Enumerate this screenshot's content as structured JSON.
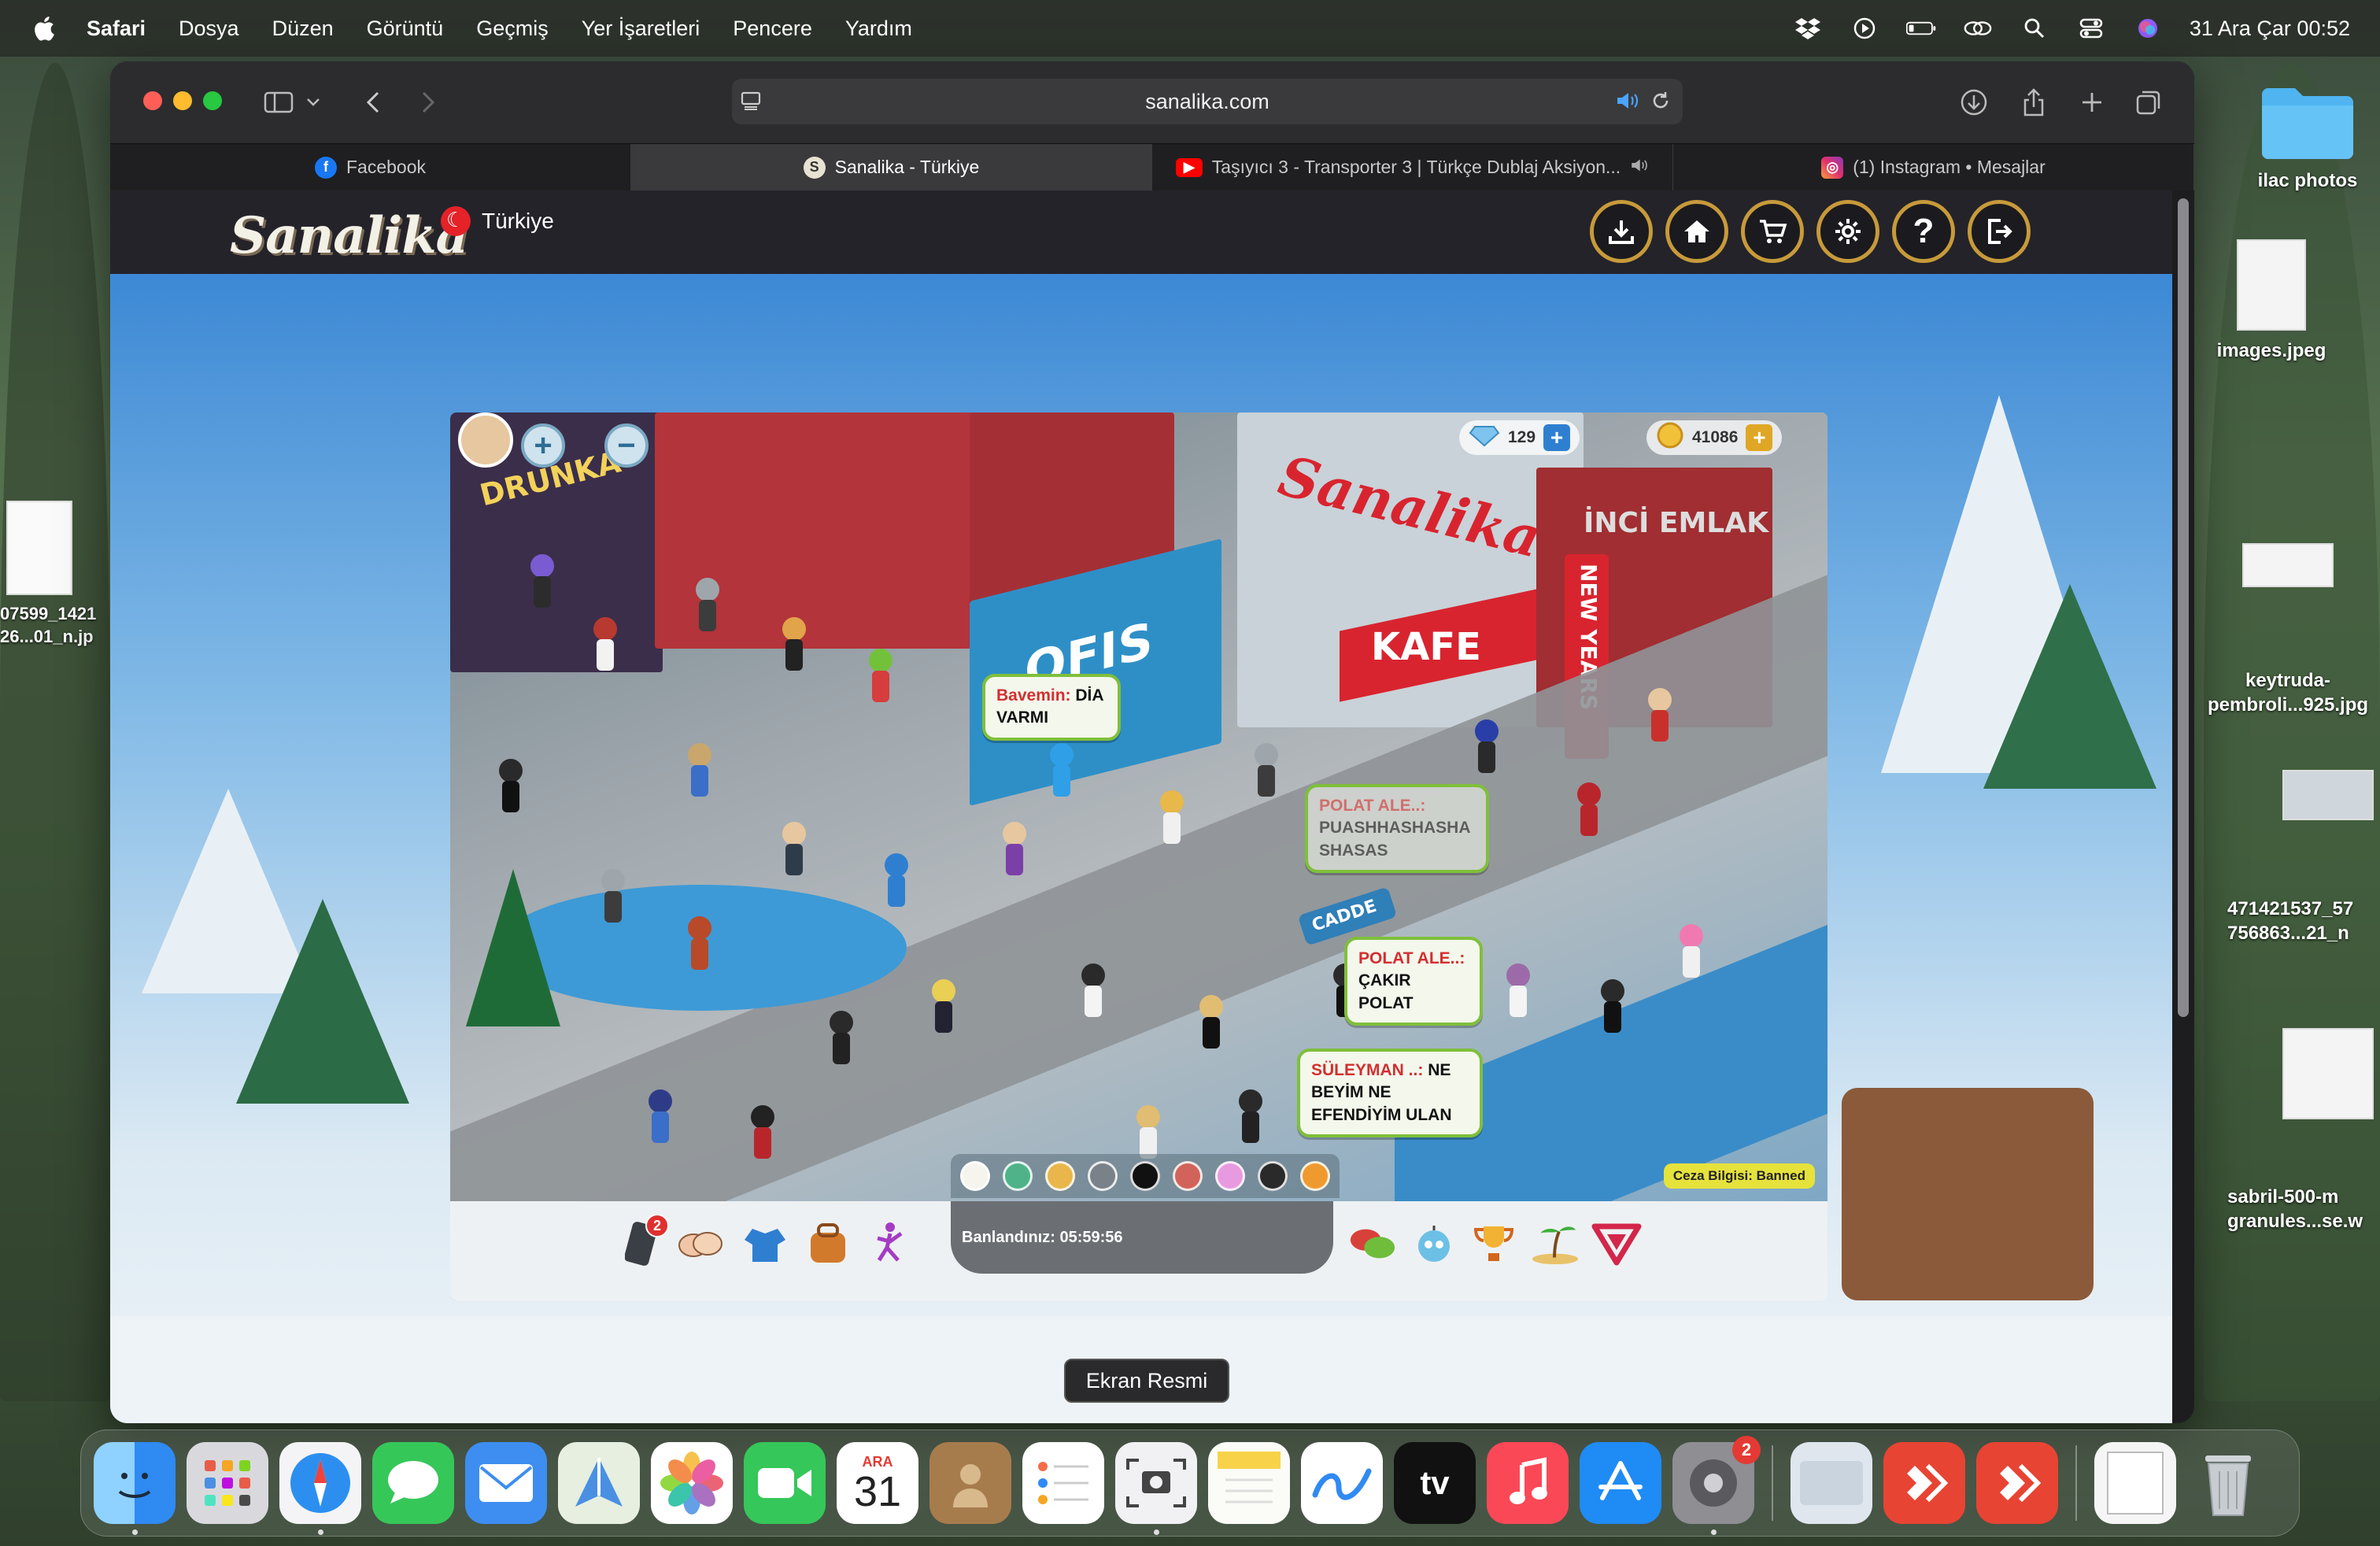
{
  "menubar": {
    "app_name": "Safari",
    "items": [
      "Dosya",
      "Düzen",
      "Görüntü",
      "Geçmiş",
      "Yer İşaretleri",
      "Pencere",
      "Yardım"
    ],
    "datetime": "31 Ara Çar 00:52"
  },
  "browser": {
    "url": "sanalika.com",
    "tabs": [
      {
        "label": "Facebook",
        "icon": "facebook-icon"
      },
      {
        "label": "Sanalika - Türkiye",
        "icon": "sanalika-icon"
      },
      {
        "label": "Taşıyıcı 3 - Transporter 3 | Türkçe Dublaj Aksiyon...",
        "icon": "youtube-icon"
      },
      {
        "label": "(1) Instagram • Mesajlar",
        "icon": "instagram-icon"
      }
    ]
  },
  "site": {
    "logo": "Sanalika",
    "country": "Türkiye",
    "header_buttons": [
      "download-button",
      "home-button",
      "cart-button",
      "settings-button",
      "help-button",
      "logout-button"
    ]
  },
  "game": {
    "diamonds": "129",
    "coins": "41086",
    "signs": {
      "ofis": "OFIS",
      "kafe": "KAFE",
      "brand": "Sanalika",
      "new_years": "NEW YEARS",
      "emlak": "İNCİ EMLAK",
      "cadde": "CADDE"
    },
    "chats": [
      {
        "name": "Bavemin:",
        "text": "DİA VARMI"
      },
      {
        "name": "POLAT ALE..:",
        "text": "PUASHHASHASHA SHASAS"
      },
      {
        "name": "POLAT ALE..:",
        "text": "ÇAKIR POLAT"
      },
      {
        "name": "SÜLEYMAN ..:",
        "text": "NE BEYİM NE EFENDİYİM ULAN"
      }
    ],
    "ban_info": "Ceza Bilgisi: Banned",
    "ban_timer": "Banlandınız: 05:59:56",
    "phone_badge": "2",
    "color_swatches": [
      "#f5f5ee",
      "#4fb38a",
      "#e8b64a",
      "#7a8289",
      "#111111",
      "#d2635a",
      "#e89ae0",
      "#2a2a2a",
      "#ef9a2f"
    ]
  },
  "desktop": {
    "items": [
      {
        "label": "ilac photos",
        "kind": "folder"
      },
      {
        "label": "images.jpeg",
        "kind": "image"
      },
      {
        "label": "keytruda-\npembroli...925.jpg",
        "kind": "image"
      },
      {
        "label": "471421537_57\n756863...21_n",
        "kind": "image"
      },
      {
        "label": "sabril-500-m\ngranules...se.w",
        "kind": "image"
      }
    ],
    "left_item": "07599_1421\n26...01_n.jp"
  },
  "tooltip": "Ekran Resmi",
  "dock": {
    "calendar_month": "ARA",
    "calendar_day": "31",
    "tv_label": "tv",
    "settings_badge": "2"
  }
}
